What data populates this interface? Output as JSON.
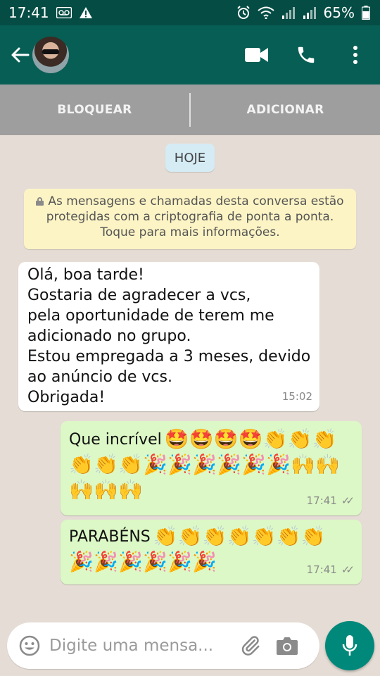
{
  "status_bar": {
    "time": "17:41",
    "battery": "65%",
    "icons": [
      "voicemail-icon",
      "warning-icon",
      "alarm-icon",
      "wifi-icon",
      "signal-icon",
      "signal-icon",
      "battery-icon"
    ]
  },
  "app_bar": {
    "icons": [
      "back-arrow-icon",
      "avatar",
      "video-call-icon",
      "phone-call-icon",
      "more-vert-icon"
    ]
  },
  "block_bar": {
    "block_label": "BLOQUEAR",
    "add_label": "ADICIONAR"
  },
  "chat": {
    "date_chip": "HOJE",
    "encryption_notice": "As mensagens e chamadas desta conversa estão protegidas com a criptografia de ponta a ponta. Toque para mais informações.",
    "messages": [
      {
        "direction": "incoming",
        "text": "Olá, boa tarde!\nGostaria de agradecer a vcs,\npela oportunidade de terem me\nadicionado no grupo.\nEstou empregada a 3 meses, devido\nao anúncio de vcs.\nObrigada!",
        "time": "15:02"
      },
      {
        "direction": "outgoing",
        "text": "Que incrível",
        "emoji_line1": [
          "🤩",
          "🤩",
          "🤩",
          "🤩",
          "👏",
          "👏",
          "👏"
        ],
        "emoji_line2": [
          "👏",
          "👏",
          "👏",
          "🎉",
          "🎉",
          "🎉",
          "🎉",
          "🎉",
          "🎉",
          "🙌",
          "🙌"
        ],
        "emoji_line3": [
          "🙌",
          "🙌",
          "🙌"
        ],
        "time": "17:41",
        "ticks": "✓✓"
      },
      {
        "direction": "outgoing",
        "text": "PARABÉNS",
        "emoji_line1": [
          "👏",
          "👏",
          "👏",
          "👏",
          "👏",
          "👏",
          "👏"
        ],
        "emoji_line2": [
          "🎉",
          "🎉",
          "🎉",
          "🎉",
          "🎉",
          "🎉"
        ],
        "time": "17:41",
        "ticks": "✓✓"
      }
    ]
  },
  "input_bar": {
    "placeholder": "Digite uma mensa...",
    "icons": [
      "emoji-icon",
      "paperclip-icon",
      "camera-icon",
      "mic-icon"
    ]
  },
  "colors": {
    "status_bar_bg": "#054d44",
    "app_bar_bg": "#075e54",
    "block_bar_bg": "#9e9e9e",
    "chat_bg": "#e5ddd5",
    "incoming_bubble": "#ffffff",
    "outgoing_bubble": "#dcf8c6",
    "date_chip_bg": "#d5ecf5",
    "encryption_bg": "#fdf4c5",
    "mic_button": "#00897b"
  }
}
